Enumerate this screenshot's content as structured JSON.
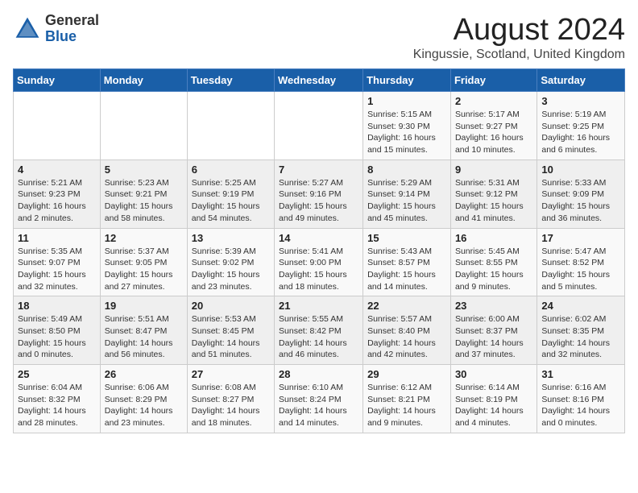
{
  "header": {
    "logo_line1": "General",
    "logo_line2": "Blue",
    "month": "August 2024",
    "location": "Kingussie, Scotland, United Kingdom"
  },
  "weekdays": [
    "Sunday",
    "Monday",
    "Tuesday",
    "Wednesday",
    "Thursday",
    "Friday",
    "Saturday"
  ],
  "weeks": [
    [
      {
        "day": "",
        "info": ""
      },
      {
        "day": "",
        "info": ""
      },
      {
        "day": "",
        "info": ""
      },
      {
        "day": "",
        "info": ""
      },
      {
        "day": "1",
        "info": "Sunrise: 5:15 AM\nSunset: 9:30 PM\nDaylight: 16 hours\nand 15 minutes."
      },
      {
        "day": "2",
        "info": "Sunrise: 5:17 AM\nSunset: 9:27 PM\nDaylight: 16 hours\nand 10 minutes."
      },
      {
        "day": "3",
        "info": "Sunrise: 5:19 AM\nSunset: 9:25 PM\nDaylight: 16 hours\nand 6 minutes."
      }
    ],
    [
      {
        "day": "4",
        "info": "Sunrise: 5:21 AM\nSunset: 9:23 PM\nDaylight: 16 hours\nand 2 minutes."
      },
      {
        "day": "5",
        "info": "Sunrise: 5:23 AM\nSunset: 9:21 PM\nDaylight: 15 hours\nand 58 minutes."
      },
      {
        "day": "6",
        "info": "Sunrise: 5:25 AM\nSunset: 9:19 PM\nDaylight: 15 hours\nand 54 minutes."
      },
      {
        "day": "7",
        "info": "Sunrise: 5:27 AM\nSunset: 9:16 PM\nDaylight: 15 hours\nand 49 minutes."
      },
      {
        "day": "8",
        "info": "Sunrise: 5:29 AM\nSunset: 9:14 PM\nDaylight: 15 hours\nand 45 minutes."
      },
      {
        "day": "9",
        "info": "Sunrise: 5:31 AM\nSunset: 9:12 PM\nDaylight: 15 hours\nand 41 minutes."
      },
      {
        "day": "10",
        "info": "Sunrise: 5:33 AM\nSunset: 9:09 PM\nDaylight: 15 hours\nand 36 minutes."
      }
    ],
    [
      {
        "day": "11",
        "info": "Sunrise: 5:35 AM\nSunset: 9:07 PM\nDaylight: 15 hours\nand 32 minutes."
      },
      {
        "day": "12",
        "info": "Sunrise: 5:37 AM\nSunset: 9:05 PM\nDaylight: 15 hours\nand 27 minutes."
      },
      {
        "day": "13",
        "info": "Sunrise: 5:39 AM\nSunset: 9:02 PM\nDaylight: 15 hours\nand 23 minutes."
      },
      {
        "day": "14",
        "info": "Sunrise: 5:41 AM\nSunset: 9:00 PM\nDaylight: 15 hours\nand 18 minutes."
      },
      {
        "day": "15",
        "info": "Sunrise: 5:43 AM\nSunset: 8:57 PM\nDaylight: 15 hours\nand 14 minutes."
      },
      {
        "day": "16",
        "info": "Sunrise: 5:45 AM\nSunset: 8:55 PM\nDaylight: 15 hours\nand 9 minutes."
      },
      {
        "day": "17",
        "info": "Sunrise: 5:47 AM\nSunset: 8:52 PM\nDaylight: 15 hours\nand 5 minutes."
      }
    ],
    [
      {
        "day": "18",
        "info": "Sunrise: 5:49 AM\nSunset: 8:50 PM\nDaylight: 15 hours\nand 0 minutes."
      },
      {
        "day": "19",
        "info": "Sunrise: 5:51 AM\nSunset: 8:47 PM\nDaylight: 14 hours\nand 56 minutes."
      },
      {
        "day": "20",
        "info": "Sunrise: 5:53 AM\nSunset: 8:45 PM\nDaylight: 14 hours\nand 51 minutes."
      },
      {
        "day": "21",
        "info": "Sunrise: 5:55 AM\nSunset: 8:42 PM\nDaylight: 14 hours\nand 46 minutes."
      },
      {
        "day": "22",
        "info": "Sunrise: 5:57 AM\nSunset: 8:40 PM\nDaylight: 14 hours\nand 42 minutes."
      },
      {
        "day": "23",
        "info": "Sunrise: 6:00 AM\nSunset: 8:37 PM\nDaylight: 14 hours\nand 37 minutes."
      },
      {
        "day": "24",
        "info": "Sunrise: 6:02 AM\nSunset: 8:35 PM\nDaylight: 14 hours\nand 32 minutes."
      }
    ],
    [
      {
        "day": "25",
        "info": "Sunrise: 6:04 AM\nSunset: 8:32 PM\nDaylight: 14 hours\nand 28 minutes."
      },
      {
        "day": "26",
        "info": "Sunrise: 6:06 AM\nSunset: 8:29 PM\nDaylight: 14 hours\nand 23 minutes."
      },
      {
        "day": "27",
        "info": "Sunrise: 6:08 AM\nSunset: 8:27 PM\nDaylight: 14 hours\nand 18 minutes."
      },
      {
        "day": "28",
        "info": "Sunrise: 6:10 AM\nSunset: 8:24 PM\nDaylight: 14 hours\nand 14 minutes."
      },
      {
        "day": "29",
        "info": "Sunrise: 6:12 AM\nSunset: 8:21 PM\nDaylight: 14 hours\nand 9 minutes."
      },
      {
        "day": "30",
        "info": "Sunrise: 6:14 AM\nSunset: 8:19 PM\nDaylight: 14 hours\nand 4 minutes."
      },
      {
        "day": "31",
        "info": "Sunrise: 6:16 AM\nSunset: 8:16 PM\nDaylight: 14 hours\nand 0 minutes."
      }
    ]
  ]
}
